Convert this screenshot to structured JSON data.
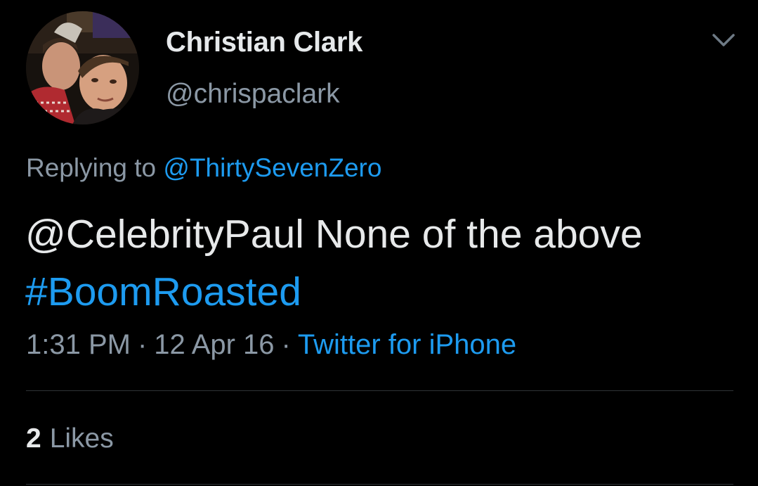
{
  "author": {
    "display_name": "Christian Clark",
    "handle": "@chrispaclark"
  },
  "reply": {
    "prefix": "Replying to",
    "mention": "@ThirtySevenZero"
  },
  "tweet": {
    "line1": "@CelebrityPaul None of the above",
    "hashtag": "#BoomRoasted"
  },
  "meta": {
    "time": "1:31 PM",
    "separator": "·",
    "date": "12 Apr 16",
    "source": "Twitter for iPhone"
  },
  "stats": {
    "likes_count": "2",
    "likes_label": "Likes"
  },
  "colors": {
    "background": "#000000",
    "primary_text": "#e7e9ea",
    "secondary_text": "#8b98a5",
    "link": "#1d9bf0",
    "divider": "#2f3336"
  },
  "icons": {
    "menu": "chevron-down-icon"
  }
}
